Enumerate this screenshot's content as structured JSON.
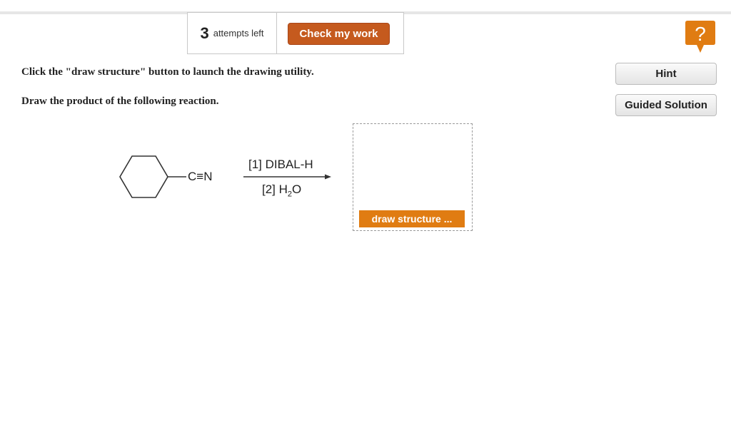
{
  "header": {
    "attempts_count": "3",
    "attempts_text": "attempts left",
    "check_label": "Check my work",
    "help_symbol": "?"
  },
  "question": {
    "instruction": "Click the \"draw structure\" button to launch the drawing utility.",
    "prompt": "Draw the product of the following reaction."
  },
  "side_buttons": {
    "hint_label": "Hint",
    "guided_solution_label": "Guided Solution"
  },
  "reaction": {
    "substituent": "C≡N",
    "reagent_1": "[1] DIBAL-H",
    "reagent_2_prefix": "[2] H",
    "reagent_2_subscript": "2",
    "reagent_2_suffix": "O"
  },
  "draw_area": {
    "button_label": "draw structure ..."
  },
  "colors": {
    "check_button": "#c55a1e",
    "draw_button": "#e07c12",
    "help_badge": "#e07c12"
  }
}
